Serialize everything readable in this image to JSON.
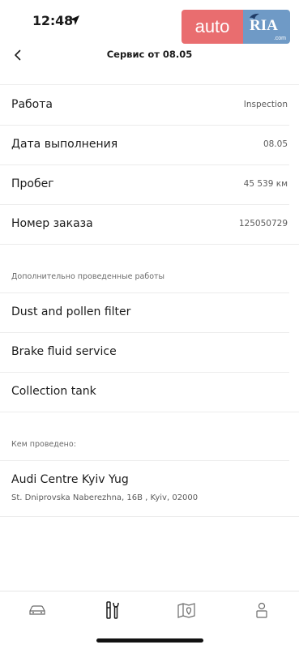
{
  "status_bar": {
    "time": "12:48"
  },
  "watermark": {
    "left_text": "auto",
    "right_text": "RIA",
    "suffix": ".com"
  },
  "header": {
    "title": "Сервис от 08.05"
  },
  "details": [
    {
      "label": "Работа",
      "value": "Inspection"
    },
    {
      "label": "Дата выполнения",
      "value": "08.05"
    },
    {
      "label": "Пробег",
      "value": "45 539 км"
    },
    {
      "label": "Номер заказа",
      "value": "125050729"
    }
  ],
  "additional_works": {
    "title": "Дополнительно проведенные работы",
    "items": [
      "Dust and pollen filter",
      "Brake fluid service",
      "Collection tank"
    ]
  },
  "performed_by": {
    "title": "Кем проведено:",
    "dealer_name": "Audi Centre Kyiv Yug",
    "dealer_address": "St. Dniprovska Naberezhna, 16B , Kyiv, 02000"
  },
  "tab_bar": {
    "tabs": [
      {
        "icon": "car-icon"
      },
      {
        "icon": "service-tools-icon",
        "active": true
      },
      {
        "icon": "map-location-icon"
      },
      {
        "icon": "user-icon"
      }
    ]
  }
}
